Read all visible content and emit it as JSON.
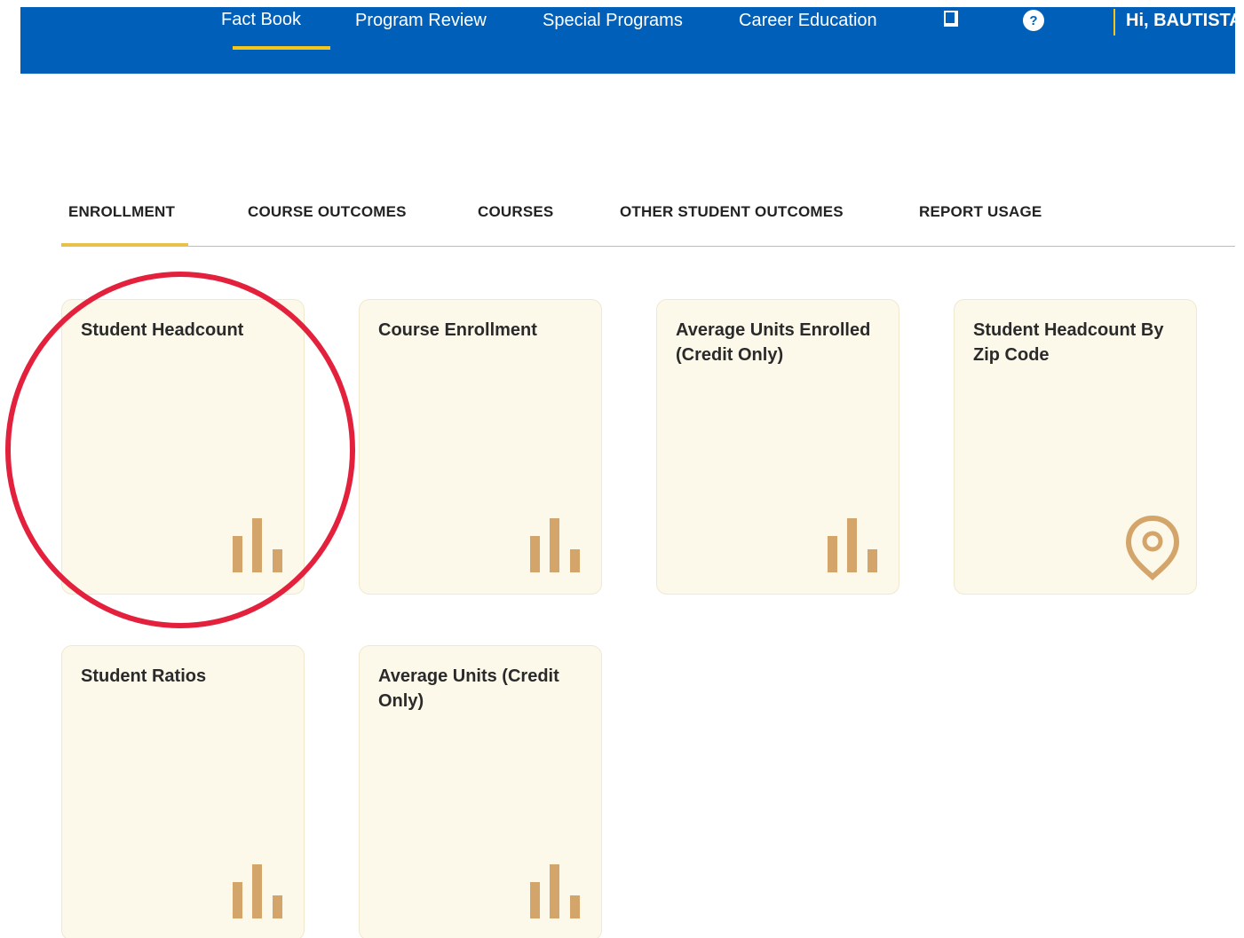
{
  "nav": {
    "items": [
      "Fact Book",
      "Program Review",
      "Special Programs",
      "Career Education"
    ],
    "greeting": "Hi, BAUTISTA",
    "icons": [
      "document-icon",
      "help-icon"
    ],
    "help_glyph": "?",
    "colors": {
      "bar": "#0060b9",
      "active_underline": "#f5c518"
    }
  },
  "tabs": {
    "items": [
      "ENROLLMENT",
      "COURSE OUTCOMES",
      "COURSES",
      "OTHER STUDENT OUTCOMES",
      "REPORT USAGE"
    ],
    "active": "ENROLLMENT",
    "colors": {
      "active_underline": "#e8c14a"
    }
  },
  "cards": [
    {
      "title": "Student Headcount",
      "icon": "bar-chart-icon"
    },
    {
      "title": "Course Enrollment",
      "icon": "bar-chart-icon"
    },
    {
      "title": "Average Units Enrolled (Credit Only)",
      "icon": "bar-chart-icon"
    },
    {
      "title": "Student Headcount By Zip Code",
      "icon": "map-pin-icon"
    },
    {
      "title": "Student Ratios",
      "icon": "bar-chart-icon"
    },
    {
      "title": "Average Units (Credit Only)",
      "icon": "bar-chart-icon"
    }
  ],
  "colors": {
    "card_bg": "#fdf9ea",
    "icon": "#d4a56a",
    "annotation": "#e4213d"
  }
}
